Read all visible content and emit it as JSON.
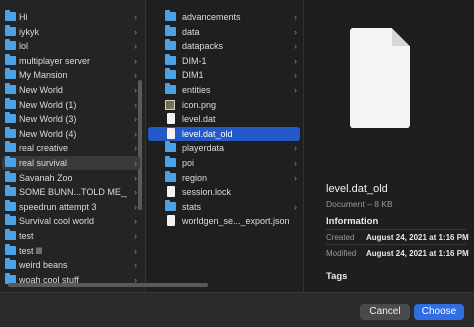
{
  "column1": {
    "items": [
      {
        "label": "Hi",
        "icon": "folder-icon"
      },
      {
        "label": "iykyk",
        "icon": "folder-icon"
      },
      {
        "label": "lol",
        "icon": "folder-icon"
      },
      {
        "label": "multiplayer server",
        "icon": "folder-icon"
      },
      {
        "label": "My Mansion",
        "icon": "folder-icon"
      },
      {
        "label": "New World",
        "icon": "folder-icon"
      },
      {
        "label": "New World (1)",
        "icon": "folder-icon"
      },
      {
        "label": "New World (3)",
        "icon": "folder-icon"
      },
      {
        "label": "New World (4)",
        "icon": "folder-icon"
      },
      {
        "label": "real creative",
        "icon": "folder-icon"
      },
      {
        "label": "real survival",
        "icon": "folder-icon"
      },
      {
        "label": "Savanah Zoo",
        "icon": "folder-icon"
      },
      {
        "label": "SOME BUNN...TOLD ME___",
        "icon": "folder-icon"
      },
      {
        "label": "speedrun attempt 3",
        "icon": "folder-icon"
      },
      {
        "label": "Survival cool world",
        "icon": "folder-icon"
      },
      {
        "label": "test",
        "icon": "folder-icon"
      },
      {
        "label": "test lll",
        "icon": "folder-icon"
      },
      {
        "label": "weird beans",
        "icon": "folder-icon"
      },
      {
        "label": "woah cool stuff",
        "icon": "folder-icon"
      }
    ],
    "selected": "real survival"
  },
  "column2": {
    "items": [
      {
        "label": "advancements",
        "icon": "folder-icon",
        "chevron": true
      },
      {
        "label": "data",
        "icon": "folder-icon",
        "chevron": true
      },
      {
        "label": "datapacks",
        "icon": "folder-icon",
        "chevron": true
      },
      {
        "label": "DIM-1",
        "icon": "folder-icon",
        "chevron": true
      },
      {
        "label": "DIM1",
        "icon": "folder-icon",
        "chevron": true
      },
      {
        "label": "entities",
        "icon": "folder-icon",
        "chevron": true
      },
      {
        "label": "icon.png",
        "icon": "image-icon",
        "chevron": false
      },
      {
        "label": "level.dat",
        "icon": "document-icon",
        "chevron": false
      },
      {
        "label": "level.dat_old",
        "icon": "document-icon",
        "chevron": false
      },
      {
        "label": "playerdata",
        "icon": "folder-icon",
        "chevron": true
      },
      {
        "label": "poi",
        "icon": "folder-icon",
        "chevron": true
      },
      {
        "label": "region",
        "icon": "folder-icon",
        "chevron": true
      },
      {
        "label": "session.lock",
        "icon": "document-icon",
        "chevron": false
      },
      {
        "label": "stats",
        "icon": "folder-icon",
        "chevron": true
      },
      {
        "label": "worldgen_se..._export.json",
        "icon": "document-icon",
        "chevron": false
      }
    ],
    "selected": "level.dat_old"
  },
  "preview": {
    "name": "level.dat_old",
    "kind": "Document – 8 KB",
    "information_heading": "Information",
    "created_label": "Created",
    "created_value": "August 24, 2021 at 1:16 PM",
    "modified_label": "Modified",
    "modified_value": "August 24, 2021 at 1:16 PM",
    "tags_heading": "Tags"
  },
  "buttons": {
    "cancel": "Cancel",
    "choose": "Choose"
  },
  "colors": {
    "accent": "#2459c8",
    "folder": "#4ba3e6",
    "choose_button": "#2f6de0"
  }
}
